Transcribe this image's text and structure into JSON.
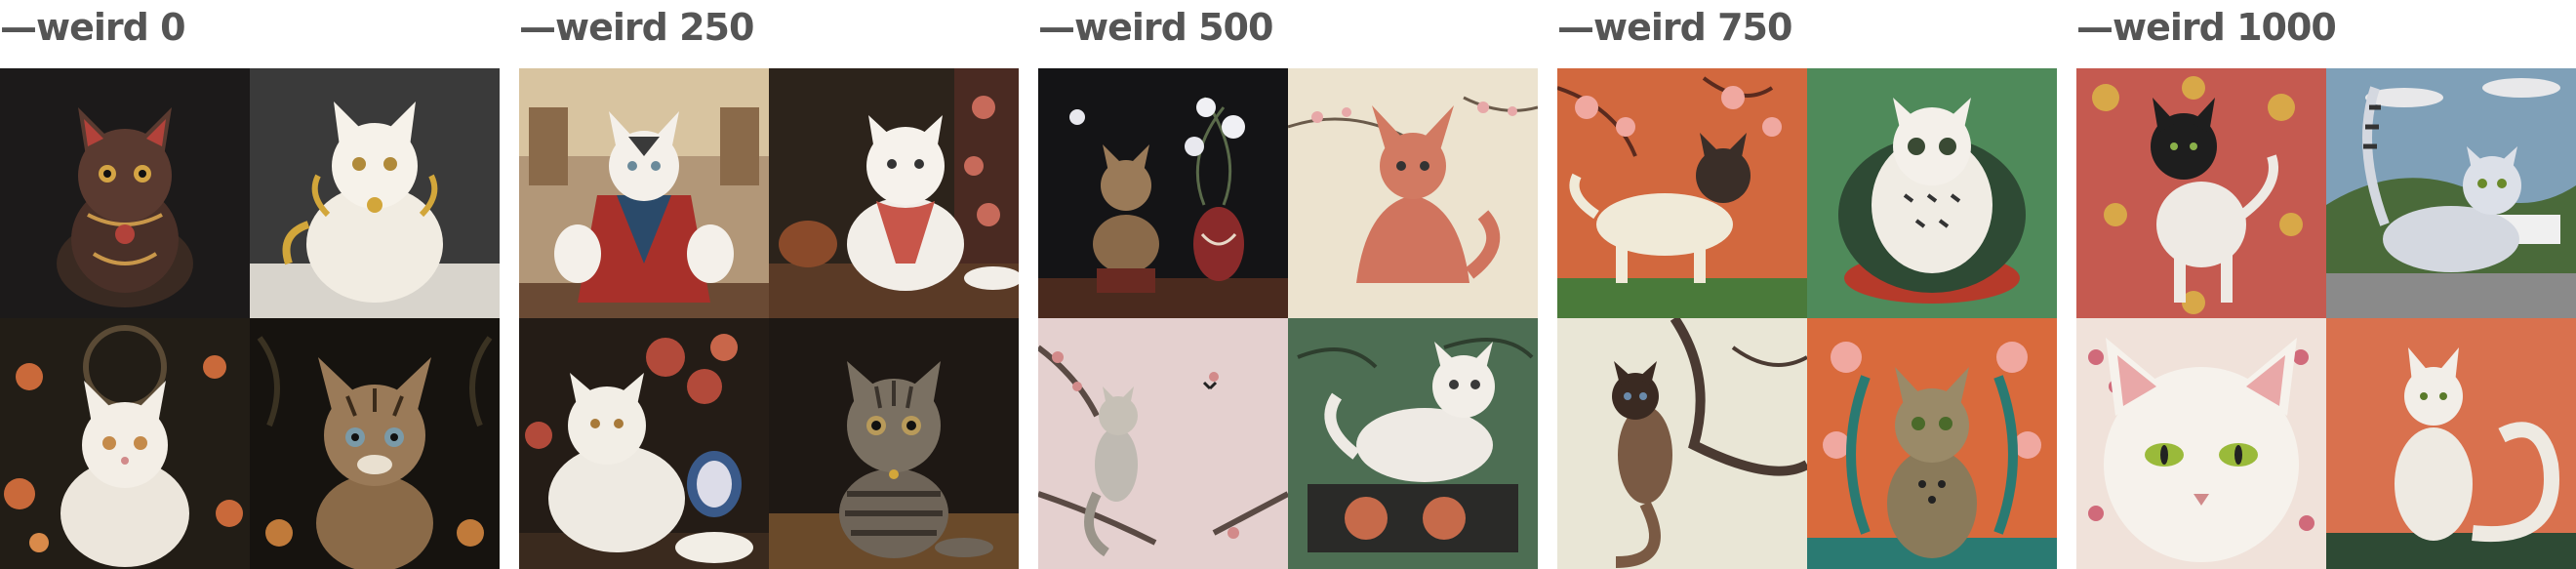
{
  "panels": [
    {
      "label": "—weird 0",
      "images": [
        {
          "subject": "ornate-dark-cat-figurine",
          "bg": "#1c1a1a"
        },
        {
          "subject": "white-gold-baroque-cat",
          "bg": "#3a3a3a"
        },
        {
          "subject": "fluffy-white-cat-flowers",
          "bg": "#221d16"
        },
        {
          "subject": "tabby-kitten-dark-ornament",
          "bg": "#16130f"
        }
      ]
    },
    {
      "label": "—weird 250",
      "images": [
        {
          "subject": "white-cat-red-robe",
          "bg": "#b29778"
        },
        {
          "subject": "white-cat-scarf-portrait",
          "bg": "#2c231b"
        },
        {
          "subject": "white-longhair-cat-flowers",
          "bg": "#241c16"
        },
        {
          "subject": "striped-tabby-cat-sitting",
          "bg": "#1e1814"
        }
      ]
    },
    {
      "label": "—weird 500",
      "images": [
        {
          "subject": "cat-vase-still-life",
          "bg": "#141416"
        },
        {
          "subject": "pink-cat-blossoms",
          "bg": "#ece3cf"
        },
        {
          "subject": "cat-on-blossom-branch",
          "bg": "#e4d0cf"
        },
        {
          "subject": "white-cat-on-box",
          "bg": "#4d6e53"
        }
      ]
    },
    {
      "label": "—weird 750",
      "images": [
        {
          "subject": "siamese-cat-orange",
          "bg": "#d2683e"
        },
        {
          "subject": "owl-cat-ceramic",
          "bg": "#4f8a5a"
        },
        {
          "subject": "siamese-cat-on-branch",
          "bg": "#e9e6d6"
        },
        {
          "subject": "tabby-cat-orange-flowers",
          "bg": "#d96a3c"
        }
      ]
    },
    {
      "label": "—weird 1000",
      "images": [
        {
          "subject": "black-white-cat-red-pattern",
          "bg": "#c55a50"
        },
        {
          "subject": "grey-cat-landscape",
          "bg": "#7fa0b8"
        },
        {
          "subject": "white-cat-face-blossoms",
          "bg": "#f0e2da"
        },
        {
          "subject": "white-cat-orange-bg",
          "bg": "#d9714e"
        }
      ]
    }
  ]
}
